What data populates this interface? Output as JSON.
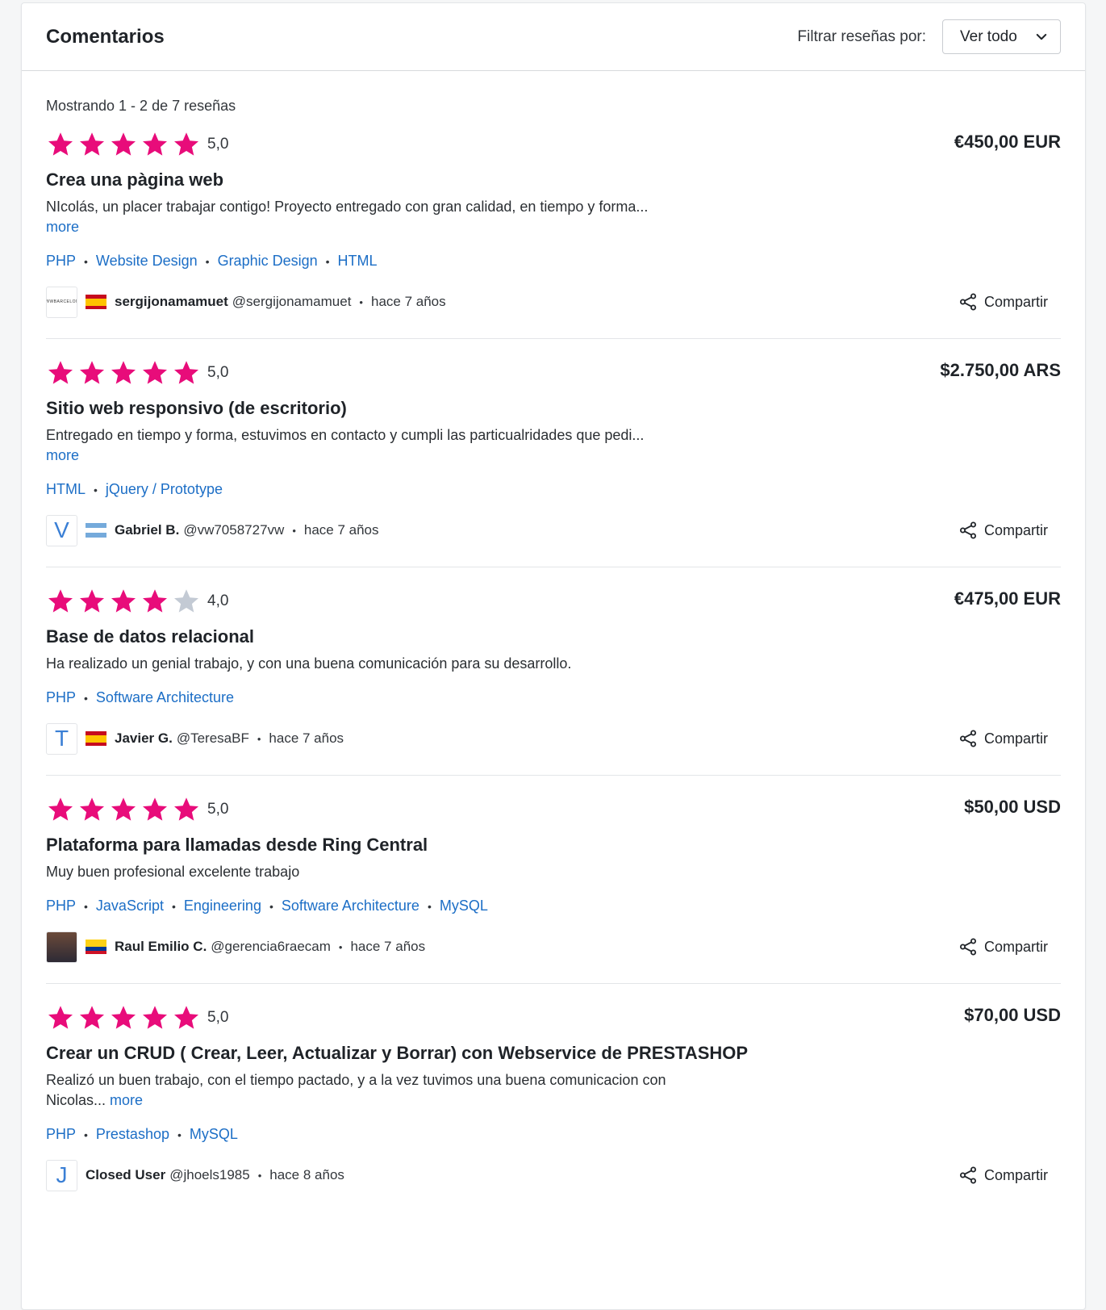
{
  "header": {
    "title": "Comentarios",
    "filter_label": "Filtrar reseñas por:",
    "filter_value": "Ver todo"
  },
  "count_text": "Mostrando 1 - 2 de 7 reseñas",
  "colors": {
    "star_filled": "#e80c7a",
    "star_empty": "#c3cad4",
    "link": "#1c6ec6"
  },
  "reviews": [
    {
      "rating": 5,
      "rating_text": "5,0",
      "price": "€450,00 EUR",
      "title": "Crea una pàgina web",
      "desc": "NIcolás, un placer trabajar contigo! Proyecto entregado con gran calidad, en tiempo y forma...",
      "more": "more",
      "skills": [
        "PHP",
        "Website Design",
        "Graphic Design",
        "HTML"
      ],
      "avatar": "",
      "avatar_logo_text": "WWWBARCELONA",
      "flag": "spain",
      "username": "sergijonamamuet",
      "handle": "@sergijonamamuet",
      "time": "hace 7 años",
      "share": "Compartir"
    },
    {
      "rating": 5,
      "rating_text": "5,0",
      "price": "$2.750,00 ARS",
      "title": "Sitio web responsivo (de escritorio)",
      "desc": "Entregado en tiempo y forma, estuvimos en contacto y cumpli las particualridades que pedi...",
      "more": "more",
      "skills": [
        "HTML",
        "jQuery / Prototype"
      ],
      "avatar": "V",
      "flag": "argentina",
      "username": "Gabriel B.",
      "handle": "@vw7058727vw",
      "time": "hace 7 años",
      "share": "Compartir"
    },
    {
      "rating": 4,
      "rating_text": "4,0",
      "price": "€475,00 EUR",
      "title": "Base de datos relacional",
      "desc": "Ha realizado un genial trabajo, y con una buena comunicación para su desarrollo.",
      "more": "",
      "skills": [
        "PHP",
        "Software Architecture"
      ],
      "avatar": "T",
      "flag": "spain",
      "username": "Javier G.",
      "handle": "@TeresaBF",
      "time": "hace 7 años",
      "share": "Compartir"
    },
    {
      "rating": 5,
      "rating_text": "5,0",
      "price": "$50,00 USD",
      "title": "Plataforma para llamadas desde Ring Central",
      "desc": "Muy buen profesional excelente trabajo",
      "more": "",
      "skills": [
        "PHP",
        "JavaScript",
        "Engineering",
        "Software Architecture",
        "MySQL"
      ],
      "avatar": "",
      "avatar_photo": true,
      "flag": "colombia",
      "username": "Raul Emilio C.",
      "handle": "@gerencia6raecam",
      "time": "hace 7 años",
      "share": "Compartir"
    },
    {
      "rating": 5,
      "rating_text": "5,0",
      "price": "$70,00 USD",
      "title": "Crear un CRUD ( Crear, Leer, Actualizar y Borrar) con Webservice de PRESTASHOP",
      "desc": "Realizó un buen trabajo, con el tiempo pactado, y a la vez tuvimos una buena comunicacion con Nicolas...",
      "more": "more",
      "skills": [
        "PHP",
        "Prestashop",
        "MySQL"
      ],
      "avatar": "J",
      "flag": "",
      "username": "Closed User",
      "handle": "@jhoels1985",
      "time": "hace 8 años",
      "share": "Compartir"
    }
  ]
}
